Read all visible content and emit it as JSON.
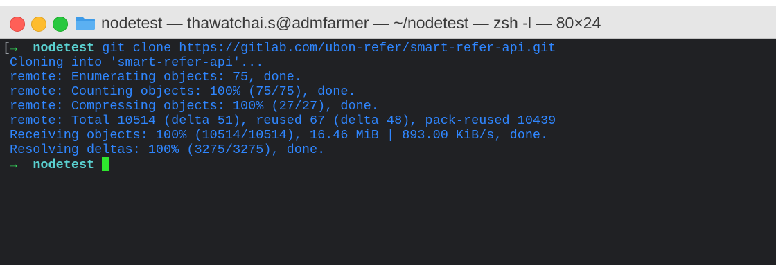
{
  "window": {
    "title": "nodetest — thawatchai.s@admfarmer — ~/nodetest — zsh -l — 80×24",
    "traffic_lights": [
      "close-button",
      "minimize-button",
      "zoom-button"
    ],
    "icon": "folder-icon"
  },
  "terminal": {
    "lines": [
      {
        "arrow": "→",
        "dir": "nodetest",
        "text": " git clone https://gitlab.com/ubon-refer/smart-refer-api.git"
      },
      {
        "text": "Cloning into 'smart-refer-api'..."
      },
      {
        "text": "remote: Enumerating objects: 75, done."
      },
      {
        "text": "remote: Counting objects: 100% (75/75), done."
      },
      {
        "text": "remote: Compressing objects: 100% (27/27), done."
      },
      {
        "text": "remote: Total 10514 (delta 51), reused 67 (delta 48), pack-reused 10439"
      },
      {
        "text": "Receiving objects: 100% (10514/10514), 16.46 MiB | 893.00 KiB/s, done."
      },
      {
        "text": "Resolving deltas: 100% (3275/3275), done."
      },
      {
        "arrow": "→",
        "dir": "nodetest",
        "text": " "
      }
    ],
    "colors": {
      "output": "#2f86ff",
      "prompt_arrow": "#34d058",
      "prompt_dir": "#5ad1d1",
      "cursor": "#2ee62e",
      "background": "#202124"
    }
  }
}
